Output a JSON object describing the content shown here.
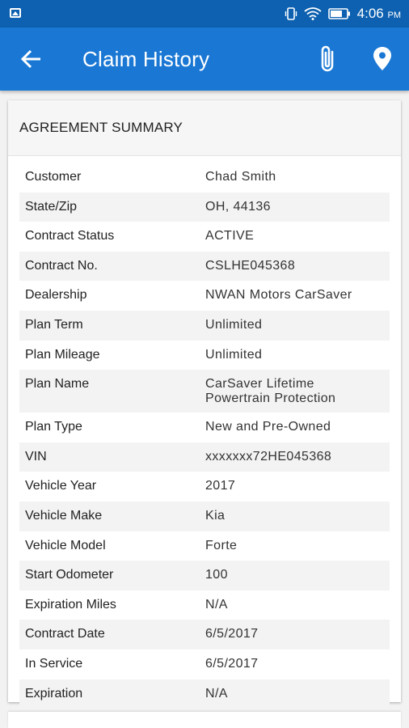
{
  "status_bar": {
    "time": "4:06",
    "ampm": "PM"
  },
  "app_bar": {
    "title": "Claim History"
  },
  "card": {
    "header": "AGREEMENT SUMMARY",
    "rows": [
      {
        "label": "Customer",
        "value": "Chad Smith"
      },
      {
        "label": "State/Zip",
        "value": "OH, 44136"
      },
      {
        "label": "Contract Status",
        "value": "ACTIVE"
      },
      {
        "label": "Contract No.",
        "value": "CSLHE045368"
      },
      {
        "label": "Dealership",
        "value": "NWAN Motors CarSaver"
      },
      {
        "label": "Plan Term",
        "value": "Unlimited"
      },
      {
        "label": "Plan Mileage",
        "value": "Unlimited"
      },
      {
        "label": "Plan Name",
        "value_line1": "CarSaver Lifetime",
        "value_line2": "Powertrain Protection"
      },
      {
        "label": "Plan Type",
        "value": "New and Pre-Owned"
      },
      {
        "label": "VIN",
        "value": "xxxxxxx72HE045368"
      },
      {
        "label": "Vehicle Year",
        "value": "2017"
      },
      {
        "label": "Vehicle Make",
        "value": "Kia"
      },
      {
        "label": "Vehicle Model",
        "value": "Forte"
      },
      {
        "label": "Start Odometer",
        "value": "100"
      },
      {
        "label": "Expiration Miles",
        "value": "N/A"
      },
      {
        "label": "Contract Date",
        "value": "6/5/2017"
      },
      {
        "label": "In Service",
        "value": "6/5/2017"
      },
      {
        "label": "Expiration",
        "value": "N/A"
      }
    ]
  },
  "colors": {
    "status_bar": "#0d61b0",
    "app_bar": "#1a78d4",
    "row_alt": "#f3f3f3"
  },
  "icons": [
    "image-icon",
    "vibrate-icon",
    "wifi-icon",
    "battery-icon",
    "back-arrow-icon",
    "paperclip-icon",
    "location-pin-icon"
  ]
}
